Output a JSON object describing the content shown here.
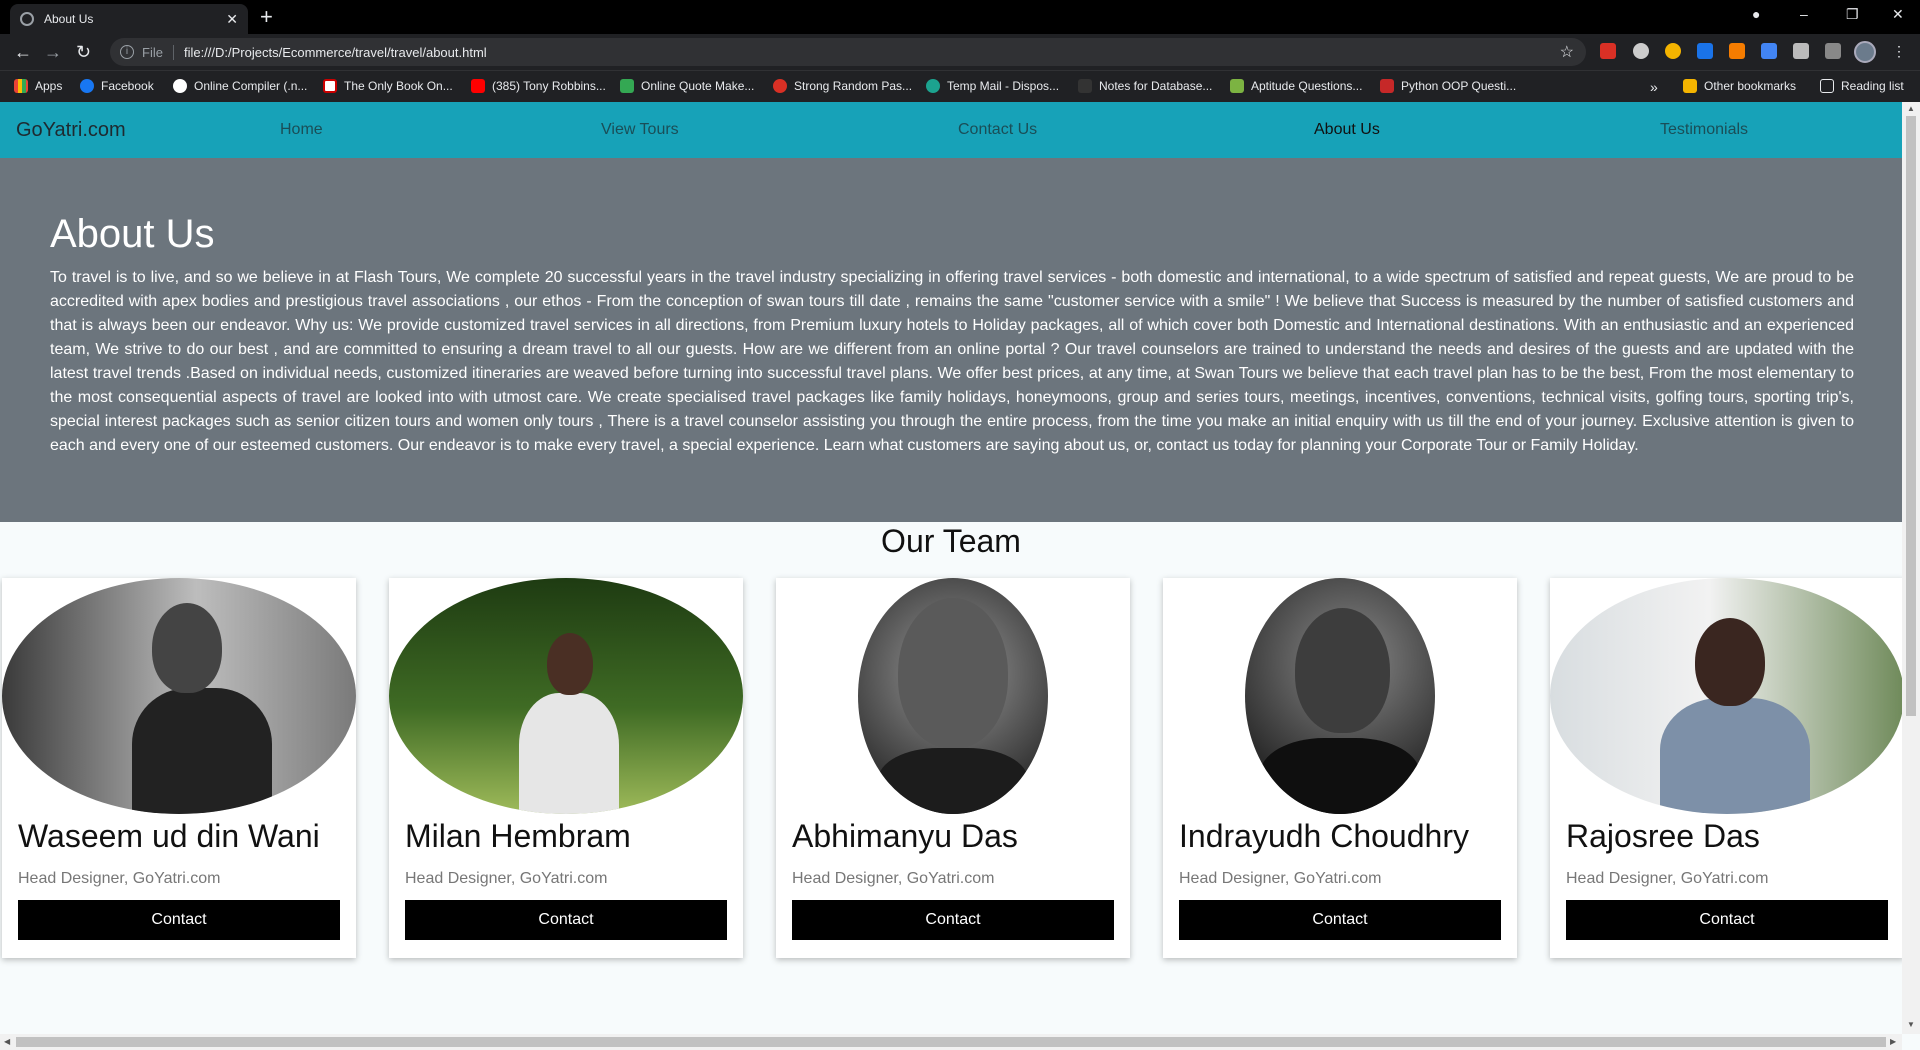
{
  "browser": {
    "tab_title": "About Us",
    "address_scheme": "File",
    "address_url": "file:///D:/Projects/Ecommerce/travel/travel/about.html",
    "bookmarks": [
      "Apps",
      "Facebook",
      "Online Compiler (.n...",
      "The Only Book On...",
      "(385) Tony Robbins...",
      "Online Quote Make...",
      "Strong Random Pas...",
      "Temp Mail - Dispos...",
      "Notes for Database...",
      "Aptitude Questions...",
      "Python OOP Questi..."
    ],
    "overflow": "»",
    "other_bookmarks": "Other bookmarks",
    "reading_list": "Reading list"
  },
  "nav": {
    "brand": "GoYatri.com",
    "links": [
      "Home",
      "View Tours",
      "Contact Us",
      "About Us",
      "Testimonials"
    ],
    "active": "About Us"
  },
  "about": {
    "title": "About Us",
    "body": "To travel is to live, and so we believe in at Flash Tours, We complete 20 successful years in the travel industry specializing in offering travel services - both domestic and international, to a wide spectrum of satisfied and repeat guests, We are proud to be accredited with apex bodies and prestigious travel associations , our ethos - From the conception of swan tours till date , remains the same \"customer service with a smile\" ! We believe that Success is measured by the number of satisfied customers and that is always been our endeavor. Why us: We provide customized travel services in all directions, from Premium luxury hotels to Holiday packages, all of which cover both Domestic and International destinations. With an enthusiastic and an experienced team, We strive to do our best , and are committed to ensuring a dream travel to all our guests. How are we different from an online portal ? Our travel counselors are trained to understand the needs and desires of the guests and are updated with the latest travel trends .Based on individual needs, customized itineraries are weaved before turning into successful travel plans. We offer best prices, at any time, at Swan Tours we believe that each travel plan has to be the best, From the most elementary to the most consequential aspects of travel are looked into with utmost care. We create specialised travel packages like family holidays, honeymoons, group and series tours, meetings, incentives, conventions, technical visits, golfing tours, sporting trip's, special interest packages such as senior citizen tours and women only tours , There is a travel counselor assisting you through the entire process, from the time you make an initial enquiry with us till the end of your journey. Exclusive attention is given to each and every one of our esteemed customers. Our endeavor is to make every travel, a special experience. Learn what customers are saying about us, or, contact us today for planning your Corporate Tour or Family Holiday."
  },
  "team": {
    "title": "Our Team",
    "members": [
      {
        "name": "Waseem ud din Wani",
        "role": "Head Designer, GoYatri.com",
        "button": "Contact"
      },
      {
        "name": "Milan Hembram",
        "role": "Head Designer, GoYatri.com",
        "button": "Contact"
      },
      {
        "name": "Abhimanyu Das",
        "role": "Head Designer, GoYatri.com",
        "button": "Contact"
      },
      {
        "name": "Indrayudh Choudhry",
        "role": "Head Designer, GoYatri.com",
        "button": "Contact"
      },
      {
        "name": "Rajosree Das",
        "role": "Head Designer, GoYatri.com",
        "button": "Contact"
      }
    ]
  },
  "colors": {
    "nav_bg": "#17a2b8",
    "hero_bg": "#6c757d",
    "button_bg": "#000000"
  }
}
